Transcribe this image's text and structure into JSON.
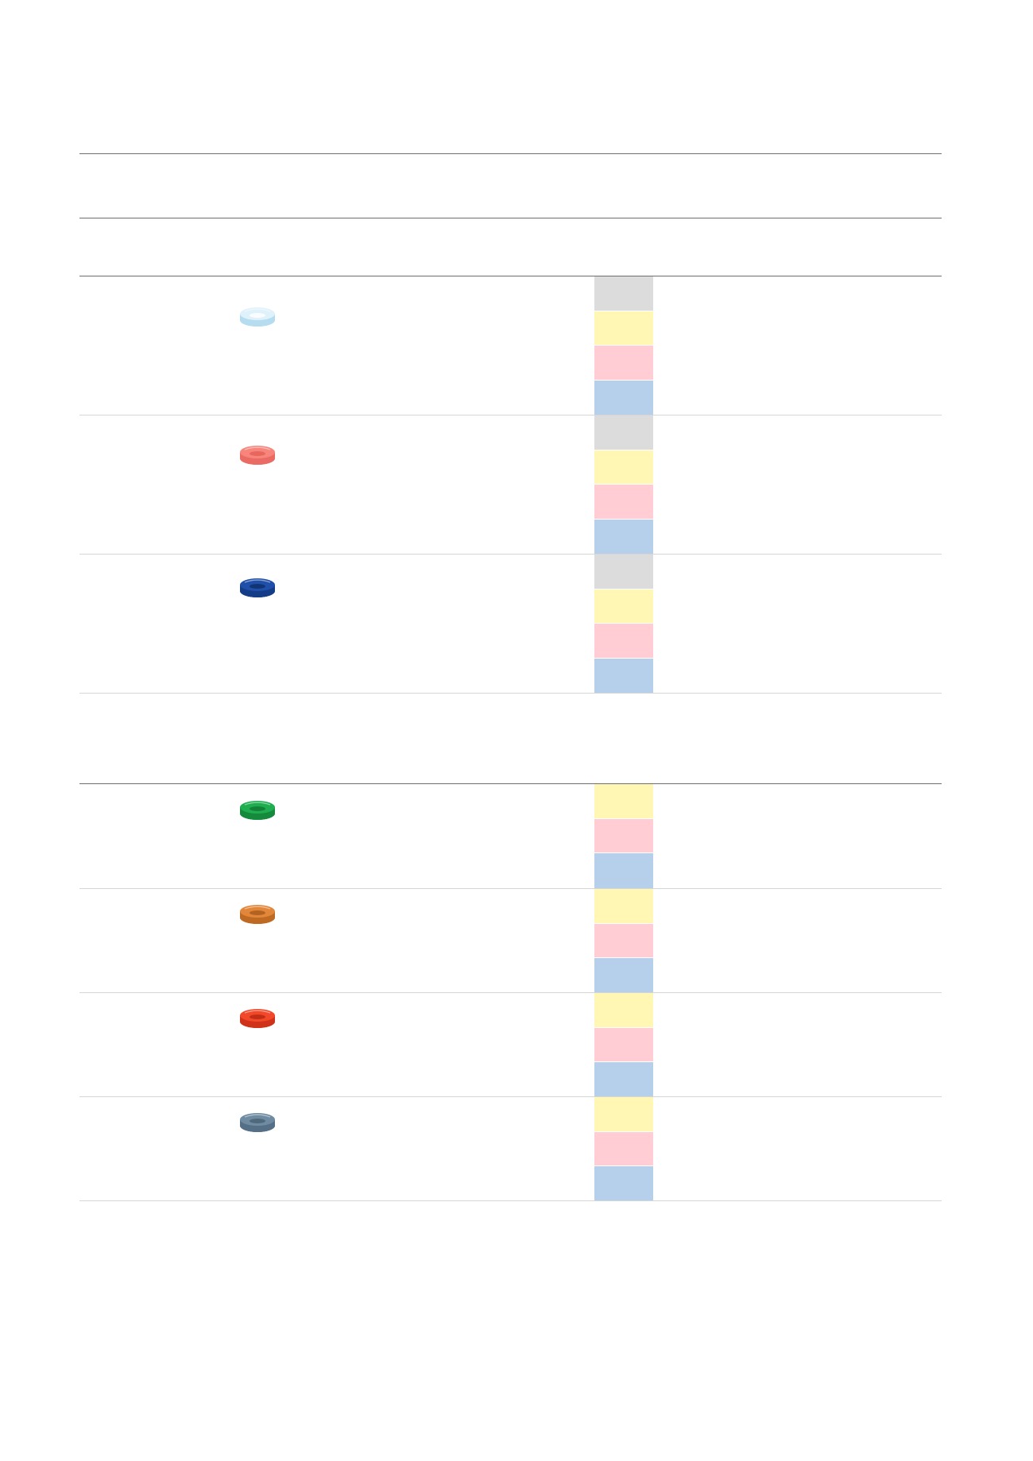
{
  "colors": {
    "rule_dark": "#6e6e6e",
    "rule_light": "#d6d6d6",
    "swatch_grey": "#dcdcdc",
    "swatch_yellow": "#fff7b3",
    "swatch_pink": "#ffcdd3",
    "swatch_blue": "#b6cfeb"
  },
  "group_one": {
    "rows": [
      {
        "icon": "clear-ring-icon",
        "ring_colors": {
          "top": "#dff1fb",
          "side": "#b6dcf0",
          "hole": "#ffffff"
        },
        "swatches": [
          "#dcdcdc",
          "#fff7b3",
          "#ffcdd3",
          "#b6cfeb"
        ]
      },
      {
        "icon": "pink-ring-icon",
        "ring_colors": {
          "top": "#f7857c",
          "side": "#ea6b63",
          "hole": "#e46058"
        },
        "swatches": [
          "#dcdcdc",
          "#fff7b3",
          "#ffcdd3",
          "#b6cfeb"
        ]
      },
      {
        "icon": "blue-ring-icon",
        "ring_colors": {
          "top": "#1f4fa8",
          "side": "#153c86",
          "hole": "#0f2f6c"
        },
        "swatches": [
          "#dcdcdc",
          "#fff7b3",
          "#ffcdd3",
          "#b6cfeb"
        ]
      }
    ]
  },
  "group_two": {
    "rows": [
      {
        "icon": "green-ring-icon",
        "ring_colors": {
          "top": "#1fae4f",
          "side": "#158a3c",
          "hole": "#127a34"
        },
        "swatches": [
          "#fff7b3",
          "#ffcdd3",
          "#b6cfeb"
        ]
      },
      {
        "icon": "orange-ring-icon",
        "ring_colors": {
          "top": "#e2873a",
          "side": "#bf6a22",
          "hole": "#a95c1d"
        },
        "swatches": [
          "#fff7b3",
          "#ffcdd3",
          "#b6cfeb"
        ]
      },
      {
        "icon": "red-ring-icon",
        "ring_colors": {
          "top": "#f2482a",
          "side": "#cf3218",
          "hole": "#b82a12"
        },
        "swatches": [
          "#fff7b3",
          "#ffcdd3",
          "#b6cfeb"
        ]
      },
      {
        "icon": "grey-blue-ring-icon",
        "ring_colors": {
          "top": "#6f8ba1",
          "side": "#546f86",
          "hole": "#4a6275"
        },
        "swatches": [
          "#fff7b3",
          "#ffcdd3",
          "#b6cfeb"
        ]
      }
    ]
  }
}
